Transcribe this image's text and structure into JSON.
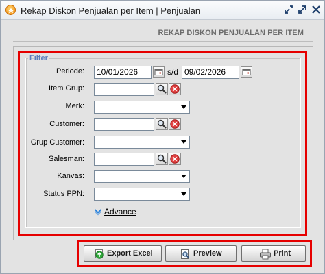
{
  "window": {
    "title": "Rekap Diskon Penjualan per Item | Penjualan"
  },
  "header": {
    "title": "REKAP DISKON PENJUALAN PER ITEM"
  },
  "filter": {
    "legend": "Filter",
    "periode": {
      "label": "Periode:",
      "start": "10/01/2026",
      "separator": "s/d",
      "end": "09/02/2026"
    },
    "item_grup": {
      "label": "Item Grup:",
      "value": ""
    },
    "merk": {
      "label": "Merk:",
      "value": ""
    },
    "customer": {
      "label": "Customer:",
      "value": ""
    },
    "grup_customer": {
      "label": "Grup Customer:",
      "value": ""
    },
    "salesman": {
      "label": "Salesman:",
      "value": ""
    },
    "kanvas": {
      "label": "Kanvas:",
      "value": ""
    },
    "status_ppn": {
      "label": "Status PPN:",
      "value": ""
    },
    "advance_label": "Advance"
  },
  "buttons": {
    "export_excel": "Export Excel",
    "preview": "Preview",
    "print": "Print"
  },
  "icons": {
    "app": "app-chevron-icon",
    "calendar": "calendar-icon",
    "search": "search-icon",
    "clear": "clear-icon",
    "advance": "chevron-down-icon"
  },
  "colors": {
    "highlight": "#e60000",
    "legend": "#5c7fbd",
    "header": "#6b6b6b"
  }
}
